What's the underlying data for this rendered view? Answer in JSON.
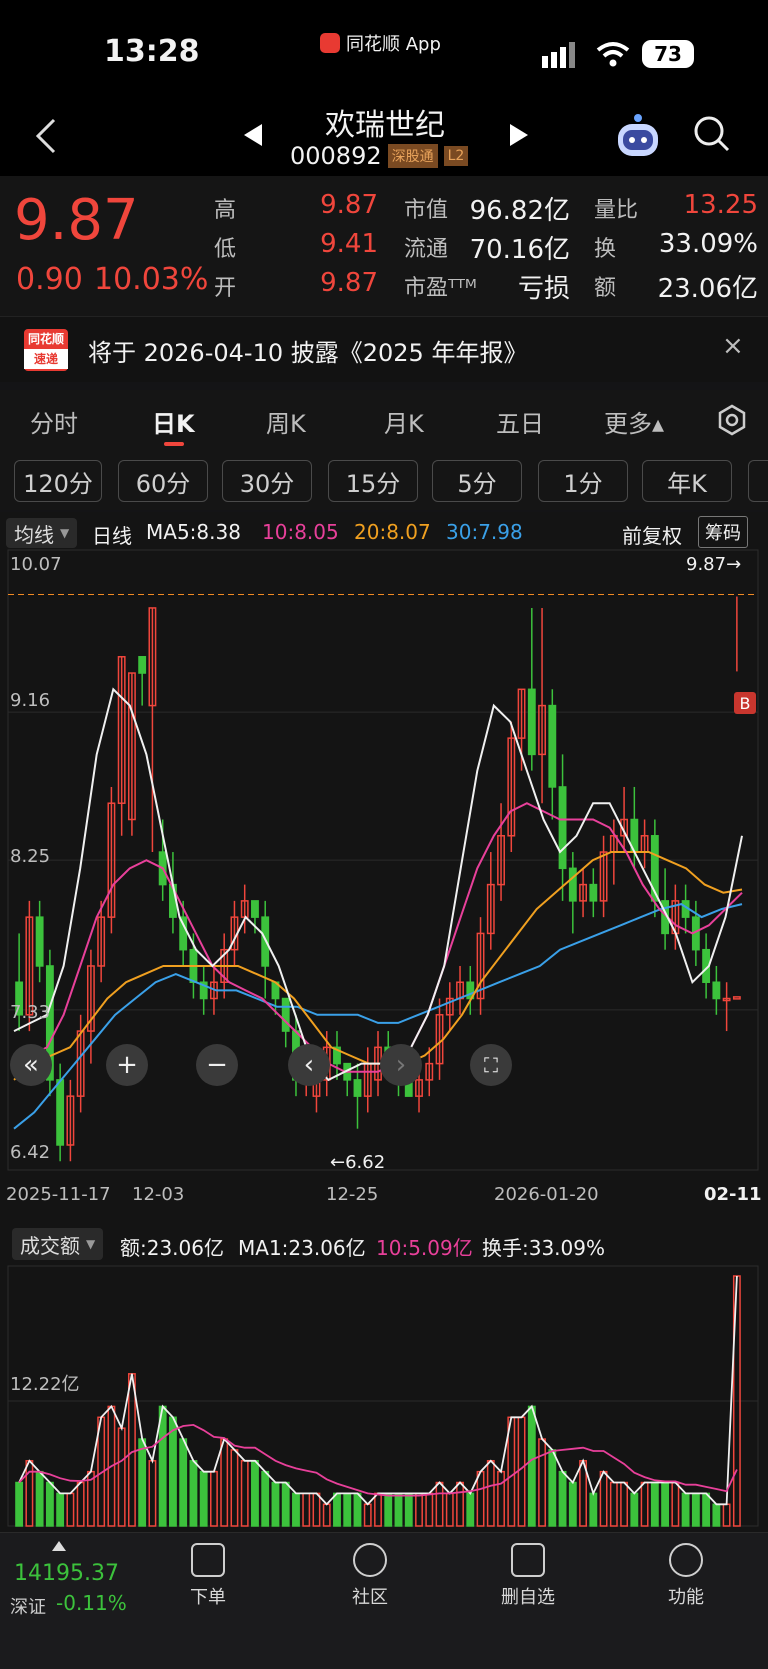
{
  "status_bar": {
    "time": "13:28",
    "app_label": "同花顺 App",
    "battery": "73"
  },
  "header": {
    "title": "欢瑞世纪",
    "code": "000892",
    "badge1": "深股通",
    "badge2": "L2"
  },
  "quote": {
    "price": "9.87",
    "change": "0.90",
    "change_pct": "10.03%",
    "stats": [
      {
        "label": "高",
        "value": "9.87"
      },
      {
        "label": "低",
        "value": "9.41"
      },
      {
        "label": "开",
        "value": "9.87"
      },
      {
        "label": "市值",
        "value": "96.82亿"
      },
      {
        "label": "流通",
        "value": "70.16亿"
      },
      {
        "label": "市盈ᵀᵀᴹ",
        "value": "亏损"
      },
      {
        "label": "量比",
        "value": "13.25"
      },
      {
        "label": "换",
        "value": "33.09%"
      },
      {
        "label": "额",
        "value": "23.06亿"
      }
    ]
  },
  "notice": {
    "badge_top": "同花顺",
    "badge_bottom": "速递",
    "text": "将于 2026-04-10 披露《2025 年年报》",
    "close": "×"
  },
  "tabs": [
    "分时",
    "日K",
    "周K",
    "月K",
    "五日",
    "更多▴"
  ],
  "active_tab": "日K",
  "periods": [
    "120分",
    "60分",
    "30分",
    "15分",
    "5分",
    "1分",
    "年K"
  ],
  "ma_bar": {
    "selector": "均线",
    "period": "日线",
    "ma5": "MA5:8.38",
    "ma10": "10:8.05",
    "ma20": "20:8.07",
    "ma30": "30:7.98",
    "adjust": "前复权",
    "chip": "筹码"
  },
  "price_chart": {
    "y_top": "10.07",
    "y_mid1": "9.16",
    "y_mid2": "8.25",
    "y_mid3": "7.33",
    "y_bottom": "6.42",
    "last_label": "9.87→",
    "low_label": "←6.62",
    "marker": "B"
  },
  "x_axis": [
    "2025-11-17",
    "12-03",
    "12-25",
    "2026-01-20",
    "02-11"
  ],
  "volume_bar": {
    "selector": "成交额",
    "amount": "额:23.06亿",
    "ma1": "MA1:23.06亿",
    "ma10": "10:5.09亿",
    "turnover": "换手:33.09%",
    "y_label": "12.22亿"
  },
  "colors": {
    "up": "#f0463c",
    "down": "#3cc23c",
    "ma5": "#f0f0f0",
    "ma10": "#e8409a",
    "ma20": "#f0a020",
    "ma30": "#3aa0e8"
  },
  "chart_data": {
    "type": "candlestick",
    "ylim": [
      6.42,
      10.07
    ],
    "x_ticks": [
      "2025-11-17",
      "12-03",
      "12-25",
      "2026-01-20",
      "02-11"
    ],
    "candles": [
      [
        7.5,
        7.3,
        7.8,
        7.2
      ],
      [
        7.3,
        7.9,
        8.0,
        7.2
      ],
      [
        7.9,
        7.6,
        8.0,
        7.5
      ],
      [
        7.6,
        6.9,
        7.7,
        6.8
      ],
      [
        6.9,
        6.5,
        7.0,
        6.4
      ],
      [
        6.5,
        6.8,
        6.9,
        6.4
      ],
      [
        6.8,
        7.2,
        7.3,
        6.7
      ],
      [
        7.2,
        7.6,
        7.7,
        7.0
      ],
      [
        7.6,
        7.9,
        8.0,
        7.5
      ],
      [
        7.9,
        8.6,
        8.7,
        7.8
      ],
      [
        8.6,
        9.5,
        9.5,
        8.4
      ],
      [
        8.5,
        9.4,
        9.4,
        8.4
      ],
      [
        9.5,
        9.4,
        9.5,
        9.2
      ],
      [
        9.2,
        9.8,
        9.8,
        8.3
      ],
      [
        8.3,
        8.1,
        8.5,
        8.0
      ],
      [
        8.1,
        7.9,
        8.3,
        7.8
      ],
      [
        7.9,
        7.7,
        8.0,
        7.6
      ],
      [
        7.7,
        7.5,
        7.8,
        7.4
      ],
      [
        7.5,
        7.4,
        7.6,
        7.3
      ],
      [
        7.4,
        7.5,
        7.6,
        7.3
      ],
      [
        7.5,
        7.7,
        7.8,
        7.4
      ],
      [
        7.7,
        7.9,
        8.0,
        7.6
      ],
      [
        7.9,
        8.0,
        8.1,
        7.8
      ],
      [
        8.0,
        7.9,
        8.0,
        7.8
      ],
      [
        7.9,
        7.6,
        8.0,
        7.4
      ],
      [
        7.5,
        7.4,
        7.5,
        7.3
      ],
      [
        7.4,
        7.2,
        7.4,
        7.1
      ],
      [
        7.2,
        6.9,
        7.3,
        6.8
      ],
      [
        6.9,
        6.9,
        7.0,
        6.8
      ],
      [
        6.8,
        6.9,
        7.1,
        6.7
      ],
      [
        6.9,
        7.1,
        7.2,
        6.8
      ],
      [
        7.1,
        7.0,
        7.2,
        6.9
      ],
      [
        7.0,
        6.9,
        7.0,
        6.8
      ],
      [
        6.9,
        6.8,
        7.0,
        6.6
      ],
      [
        6.8,
        7.0,
        7.1,
        6.7
      ],
      [
        6.9,
        7.1,
        7.2,
        6.8
      ],
      [
        7.1,
        7.0,
        7.2,
        6.9
      ],
      [
        7.0,
        6.9,
        7.1,
        6.8
      ],
      [
        6.9,
        6.8,
        7.0,
        6.8
      ],
      [
        6.8,
        6.9,
        7.0,
        6.7
      ],
      [
        6.9,
        7.0,
        7.1,
        6.8
      ],
      [
        7.0,
        7.3,
        7.4,
        6.9
      ],
      [
        7.3,
        7.4,
        7.5,
        7.2
      ],
      [
        7.4,
        7.5,
        7.6,
        7.3
      ],
      [
        7.5,
        7.4,
        7.6,
        7.3
      ],
      [
        7.4,
        7.8,
        7.9,
        7.3
      ],
      [
        7.8,
        8.1,
        8.3,
        7.7
      ],
      [
        8.1,
        8.4,
        8.6,
        8.0
      ],
      [
        8.4,
        9.0,
        9.1,
        8.3
      ],
      [
        9.0,
        9.3,
        9.3,
        8.8
      ],
      [
        9.3,
        8.9,
        9.8,
        8.8
      ],
      [
        8.9,
        9.2,
        9.8,
        8.6
      ],
      [
        9.2,
        8.7,
        9.3,
        8.5
      ],
      [
        8.7,
        8.2,
        8.9,
        8.0
      ],
      [
        8.2,
        8.0,
        8.3,
        7.8
      ],
      [
        8.0,
        8.1,
        8.2,
        7.9
      ],
      [
        8.1,
        8.0,
        8.2,
        7.9
      ],
      [
        8.0,
        8.3,
        8.4,
        7.9
      ],
      [
        8.3,
        8.4,
        8.5,
        8.1
      ],
      [
        8.4,
        8.5,
        8.7,
        8.3
      ],
      [
        8.5,
        8.3,
        8.7,
        8.2
      ],
      [
        8.3,
        8.4,
        8.5,
        8.2
      ],
      [
        8.4,
        8.0,
        8.5,
        7.9
      ],
      [
        8.0,
        7.8,
        8.2,
        7.7
      ],
      [
        7.8,
        8.0,
        8.1,
        7.7
      ],
      [
        8.0,
        7.9,
        8.1,
        7.8
      ],
      [
        7.9,
        7.7,
        8.0,
        7.6
      ],
      [
        7.7,
        7.5,
        7.8,
        7.4
      ],
      [
        7.5,
        7.4,
        7.6,
        7.3
      ],
      [
        7.4,
        7.4,
        7.5,
        7.2
      ],
      [
        7.4,
        7.41,
        9.87,
        9.41
      ]
    ],
    "ma5": [
      7.2,
      7.25,
      7.3,
      7.6,
      8.2,
      8.9,
      9.3,
      9.2,
      8.9,
      8.4,
      7.9,
      7.7,
      7.6,
      7.7,
      7.9,
      7.8,
      7.6,
      7.3,
      7.0,
      6.9,
      6.95,
      7.0,
      7.0,
      7.0,
      7.1,
      7.3,
      7.6,
      8.2,
      8.8,
      9.2,
      9.1,
      8.8,
      8.5,
      8.3,
      8.4,
      8.6,
      8.6,
      8.4,
      8.2,
      8.0,
      7.8,
      7.5,
      7.6,
      7.9,
      8.4
    ],
    "ma10": [
      7.0,
      7.05,
      7.1,
      7.3,
      7.6,
      7.9,
      8.1,
      8.2,
      8.25,
      8.2,
      8.0,
      7.8,
      7.6,
      7.5,
      7.45,
      7.4,
      7.3,
      7.2,
      7.1,
      7.0,
      6.95,
      6.95,
      6.95,
      7.0,
      7.1,
      7.3,
      7.6,
      7.9,
      8.2,
      8.4,
      8.55,
      8.6,
      8.55,
      8.5,
      8.5,
      8.5,
      8.45,
      8.3,
      8.1,
      7.95,
      7.85,
      7.8,
      7.85,
      7.95,
      8.05
    ],
    "ma20": [
      6.9,
      7.0,
      7.05,
      7.1,
      7.25,
      7.4,
      7.5,
      7.55,
      7.6,
      7.6,
      7.6,
      7.6,
      7.6,
      7.55,
      7.5,
      7.4,
      7.25,
      7.1,
      7.05,
      7.0,
      7.0,
      7.0,
      7.05,
      7.15,
      7.3,
      7.5,
      7.65,
      7.8,
      7.95,
      8.05,
      8.15,
      8.25,
      8.3,
      8.3,
      8.3,
      8.25,
      8.2,
      8.1,
      8.05,
      8.07
    ],
    "ma30": [
      6.6,
      6.7,
      6.85,
      7.0,
      7.15,
      7.3,
      7.4,
      7.5,
      7.55,
      7.5,
      7.45,
      7.45,
      7.4,
      7.35,
      7.35,
      7.3,
      7.3,
      7.3,
      7.25,
      7.25,
      7.3,
      7.35,
      7.4,
      7.45,
      7.5,
      7.55,
      7.6,
      7.7,
      7.75,
      7.8,
      7.85,
      7.9,
      7.95,
      7.98,
      7.9,
      7.95,
      7.98
    ],
    "volume": [
      4,
      6,
      5,
      4,
      3,
      3,
      4,
      5,
      10,
      11,
      9,
      14,
      8,
      6,
      11,
      10,
      8,
      6,
      5,
      5,
      8,
      7,
      6,
      6,
      5,
      4,
      4,
      3,
      3,
      3,
      2,
      3,
      3,
      3,
      2,
      3,
      3,
      3,
      3,
      3,
      3,
      4,
      3,
      4,
      3,
      5,
      6,
      5,
      10,
      10,
      11,
      8,
      7,
      5,
      4,
      6,
      3,
      5,
      4,
      4,
      3,
      4,
      4,
      4,
      4,
      3,
      3,
      3,
      2,
      2,
      23
    ]
  }
}
